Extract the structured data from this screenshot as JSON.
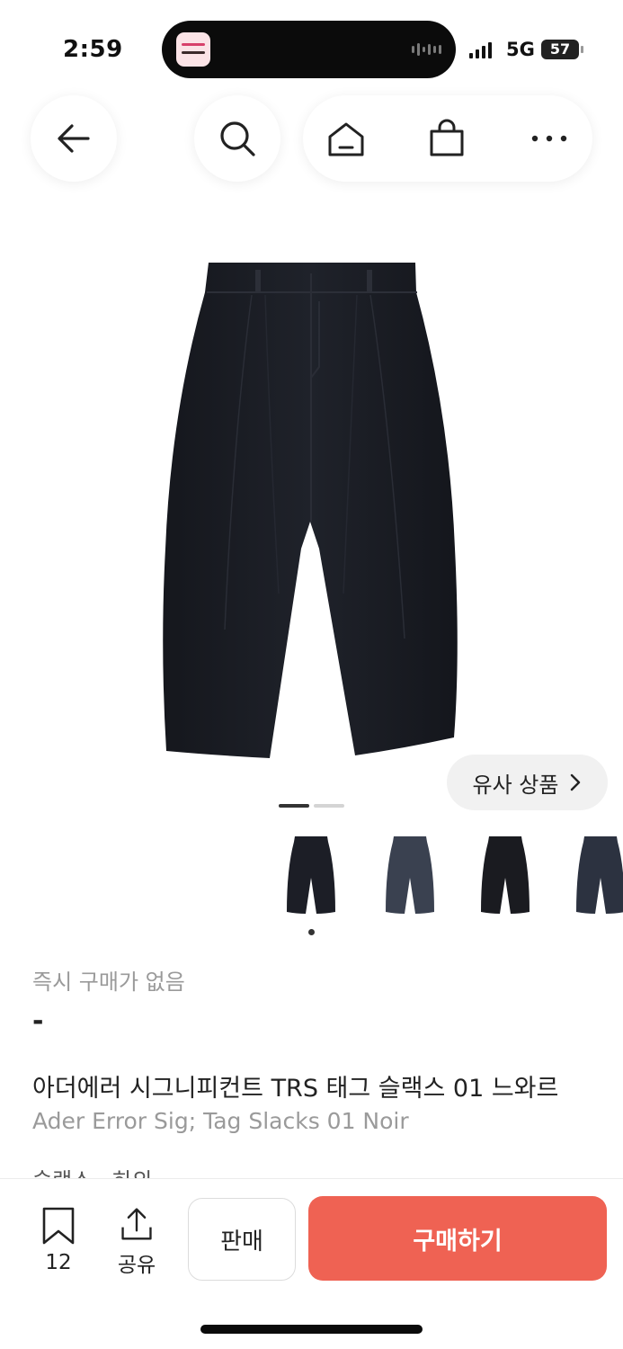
{
  "status_bar": {
    "time": "2:59",
    "network": "5G",
    "battery": "57"
  },
  "nav": {
    "back_icon": "arrow-left-icon",
    "search_icon": "search-icon",
    "home_icon": "home-icon",
    "bag_icon": "shopping-bag-icon",
    "more_icon": "more-horizontal-icon"
  },
  "gallery": {
    "current_slide": 1,
    "total_slides": 2,
    "similar_label": "유사 상품",
    "thumbnails": [
      {
        "color": "#1c1e26"
      },
      {
        "color": "#3a4150"
      },
      {
        "color": "#1a1b20"
      },
      {
        "color": "#2c3240"
      }
    ]
  },
  "product": {
    "availability": "즉시 구매가 없음",
    "price": "-",
    "title_ko": "아더에러 시그니피컨트 TRS 태그 슬랙스 01 느와르",
    "title_en": "Ader Error Sig; Tag Slacks 01 Noir",
    "tags": "슬랙스 · 하의"
  },
  "actions": {
    "bookmark_count": "12",
    "share_label": "공유",
    "sell_label": "판매",
    "buy_label": "구매하기",
    "buy_color": "#ef6253"
  }
}
